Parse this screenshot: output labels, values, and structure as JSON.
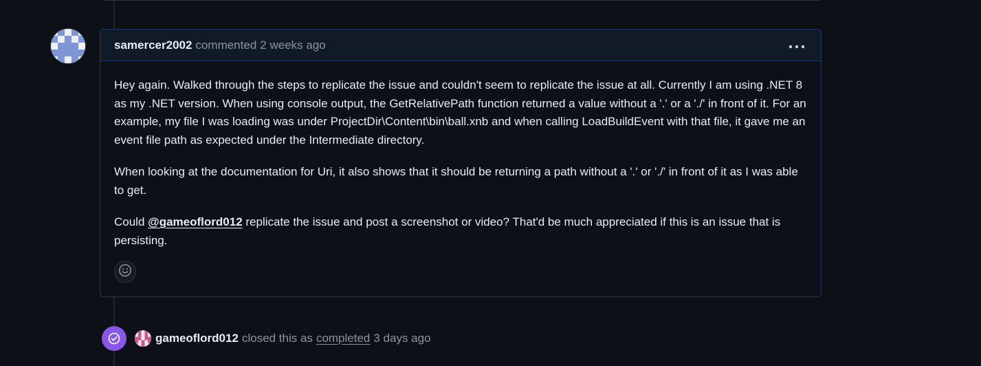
{
  "comment": {
    "author": "samercer2002",
    "action": "commented",
    "time": "2 weeks ago",
    "paragraphs": {
      "p1": "Hey again. Walked through the steps to replicate the issue and couldn't seem to replicate the issue at all. Currently I am using .NET 8 as my .NET version. When using console output, the GetRelativePath function returned a value without a '.' or a './' in front of it. For an example, my file I was loading was under ProjectDir\\Content\\bin\\ball.xnb and when calling LoadBuildEvent with that file, it gave me an event file path as expected under the Intermediate directory.",
      "p2": "When looking at the documentation for Uri, it also shows that it should be returning a path without a '.' or './' in front of it as I was able to get.",
      "p3_before": "Could ",
      "p3_mention": "@gameoflord012",
      "p3_after": " replicate the issue and post a screenshot or video? That'd be much appreciated if this is an issue that is persisting."
    },
    "menu_icon": "kebab-horizontal-icon",
    "reaction_icon": "smiley-icon"
  },
  "event": {
    "user": "gameoflord012",
    "text": "closed this as",
    "link": "completed",
    "time": "3 days ago",
    "badge_icon": "check-circle-icon",
    "badge_color": "#8957e5"
  },
  "colors": {
    "background": "#0d1117",
    "header_bg": "#111a27",
    "border": "#1f3a5f",
    "muted": "#8b949e",
    "text": "#e6edf3"
  }
}
